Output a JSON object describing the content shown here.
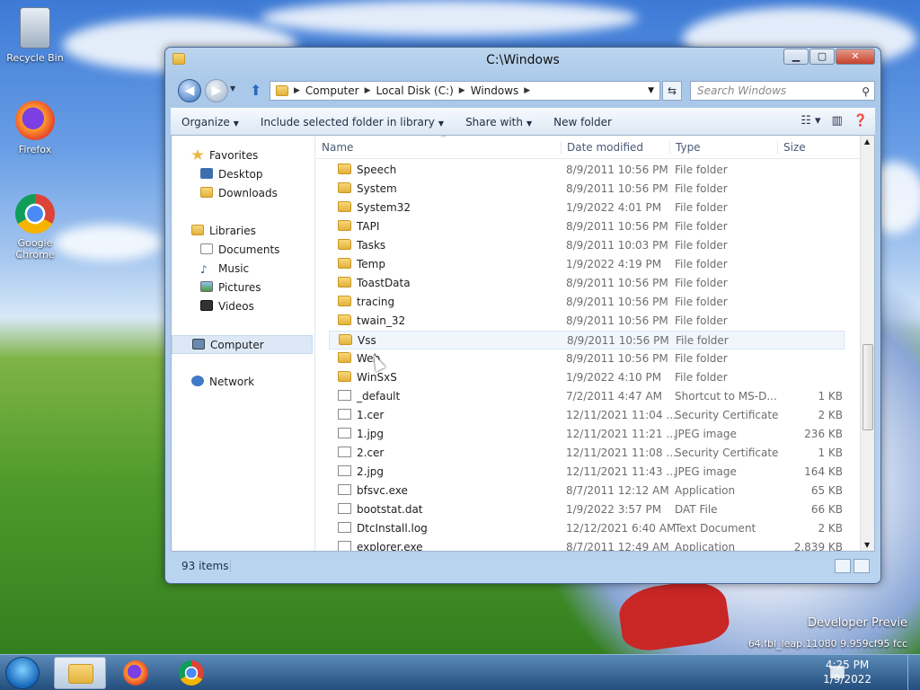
{
  "desktop": {
    "icons": [
      {
        "label": "Recycle Bin"
      },
      {
        "label": "Firefox"
      },
      {
        "label": "Google Chrome"
      }
    ],
    "watermark_line1": "Developer Previe",
    "watermark_line2": "64.fbl_leap.11080        9.959cf95     fcc"
  },
  "window": {
    "title": "C:\\Windows",
    "buttons": {
      "minimize": "▁",
      "maximize": "▢",
      "close": "✕"
    },
    "breadcrumb": [
      "Computer",
      "Local Disk (C:)",
      "Windows"
    ],
    "search_placeholder": "Search Windows",
    "commands": [
      "Organize",
      "Include selected folder in library",
      "Share with",
      "New folder"
    ],
    "columns": [
      "Name",
      "Date modified",
      "Type",
      "Size"
    ],
    "nav": {
      "favorites": "Favorites",
      "favorites_items": [
        "Desktop",
        "Downloads"
      ],
      "libraries": "Libraries",
      "libraries_items": [
        "Documents",
        "Music",
        "Pictures",
        "Videos"
      ],
      "computer": "Computer",
      "network": "Network"
    },
    "files": [
      {
        "name": "Speech",
        "date": "8/9/2011 10:56 PM",
        "type": "File folder",
        "size": "",
        "icon": "folder-icon"
      },
      {
        "name": "System",
        "date": "8/9/2011 10:56 PM",
        "type": "File folder",
        "size": "",
        "icon": "folder-icon"
      },
      {
        "name": "System32",
        "date": "1/9/2022 4:01 PM",
        "type": "File folder",
        "size": "",
        "icon": "folder-icon"
      },
      {
        "name": "TAPI",
        "date": "8/9/2011 10:56 PM",
        "type": "File folder",
        "size": "",
        "icon": "folder-icon"
      },
      {
        "name": "Tasks",
        "date": "8/9/2011 10:03 PM",
        "type": "File folder",
        "size": "",
        "icon": "folder-icon"
      },
      {
        "name": "Temp",
        "date": "1/9/2022 4:19 PM",
        "type": "File folder",
        "size": "",
        "icon": "folder-icon"
      },
      {
        "name": "ToastData",
        "date": "8/9/2011 10:56 PM",
        "type": "File folder",
        "size": "",
        "icon": "folder-icon"
      },
      {
        "name": "tracing",
        "date": "8/9/2011 10:56 PM",
        "type": "File folder",
        "size": "",
        "icon": "folder-icon"
      },
      {
        "name": "twain_32",
        "date": "8/9/2011 10:56 PM",
        "type": "File folder",
        "size": "",
        "icon": "folder-icon"
      },
      {
        "name": "Vss",
        "date": "8/9/2011 10:56 PM",
        "type": "File folder",
        "size": "",
        "icon": "folder-icon"
      },
      {
        "name": "Web",
        "date": "8/9/2011 10:56 PM",
        "type": "File folder",
        "size": "",
        "icon": "folder-icon"
      },
      {
        "name": "WinSxS",
        "date": "1/9/2022 4:10 PM",
        "type": "File folder",
        "size": "",
        "icon": "folder-icon"
      },
      {
        "name": "_default",
        "date": "7/2/2011 4:47 AM",
        "type": "Shortcut to MS-D...",
        "size": "1 KB",
        "icon": "shortcut-icon"
      },
      {
        "name": "1.cer",
        "date": "12/11/2021 11:04 ...",
        "type": "Security Certificate",
        "size": "2 KB",
        "icon": "certificate-icon"
      },
      {
        "name": "1.jpg",
        "date": "12/11/2021 11:21 ...",
        "type": "JPEG image",
        "size": "236 KB",
        "icon": "image-icon"
      },
      {
        "name": "2.cer",
        "date": "12/11/2021 11:08 ...",
        "type": "Security Certificate",
        "size": "1 KB",
        "icon": "certificate-icon"
      },
      {
        "name": "2.jpg",
        "date": "12/11/2021 11:43 ...",
        "type": "JPEG image",
        "size": "164 KB",
        "icon": "image-icon"
      },
      {
        "name": "bfsvc.exe",
        "date": "8/7/2011 12:12 AM",
        "type": "Application",
        "size": "65 KB",
        "icon": "app-icon"
      },
      {
        "name": "bootstat.dat",
        "date": "1/9/2022 3:57 PM",
        "type": "DAT File",
        "size": "66 KB",
        "icon": "file-icon"
      },
      {
        "name": "DtcInstall.log",
        "date": "12/12/2021 6:40 AM",
        "type": "Text Document",
        "size": "2 KB",
        "icon": "text-icon"
      },
      {
        "name": "explorer.exe",
        "date": "8/7/2011 12:49 AM",
        "type": "Application",
        "size": "2,839 KB",
        "icon": "explorer-icon"
      }
    ],
    "hovered_row": 9,
    "status": "93 items"
  },
  "taskbar": {
    "time": "4:25 PM",
    "date": "1/9/2022"
  },
  "colors": {
    "folder": "#e3b23c",
    "hover": "#f1f6fc",
    "taskbar": "#234e7d"
  }
}
